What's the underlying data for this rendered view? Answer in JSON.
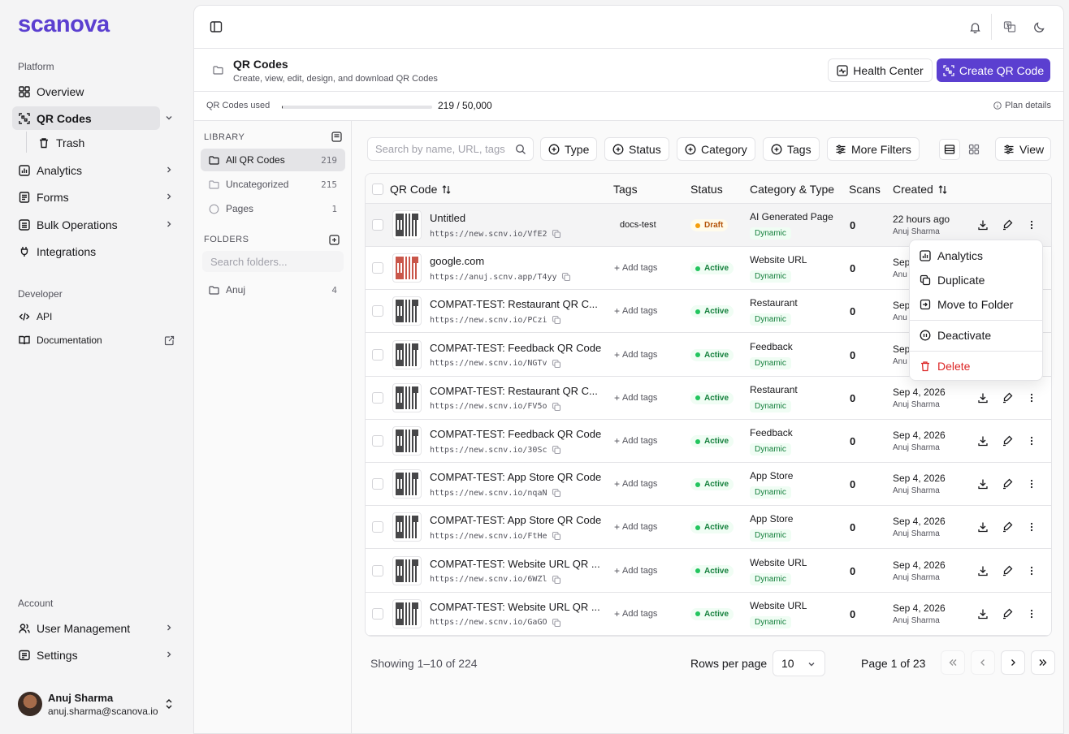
{
  "brand": {
    "logo_text": "scanova",
    "accent": "#5b3fd0"
  },
  "sidebar": {
    "platform_label": "Platform",
    "items": [
      {
        "label": "Overview",
        "icon": "grid-icon"
      },
      {
        "label": "QR Codes",
        "icon": "qr-scan-icon"
      },
      {
        "label": "Trash",
        "icon": "trash-icon"
      },
      {
        "label": "Analytics",
        "icon": "bar-chart-icon"
      },
      {
        "label": "Forms",
        "icon": "form-icon"
      },
      {
        "label": "Bulk Operations",
        "icon": "layers-icon"
      },
      {
        "label": "Integrations",
        "icon": "plug-icon"
      }
    ],
    "developer_label": "Developer",
    "dev_items": [
      {
        "label": "API",
        "icon": "code-icon"
      },
      {
        "label": "Documentation",
        "icon": "book-icon"
      }
    ],
    "account_label": "Account",
    "account_items": [
      {
        "label": "User Management",
        "icon": "users-icon"
      },
      {
        "label": "Settings",
        "icon": "settings-icon"
      }
    ],
    "user": {
      "name": "Anuj Sharma",
      "email": "anuj.sharma@scanova.io"
    }
  },
  "header": {
    "title": "QR Codes",
    "subtitle": "Create, view, edit, design, and download QR Codes",
    "health_center": "Health Center",
    "create": "Create QR Code"
  },
  "usage": {
    "label": "QR Codes used",
    "value_text": "219 / 50,000",
    "used": 219,
    "limit": 50000,
    "plan_details": "Plan details"
  },
  "library": {
    "title": "LIBRARY",
    "items": [
      {
        "label": "All QR Codes",
        "count": "219"
      },
      {
        "label": "Uncategorized",
        "count": "215"
      },
      {
        "label": "Pages",
        "count": "1"
      }
    ],
    "folders_title": "FOLDERS",
    "folder_search_placeholder": "Search folders...",
    "folders": [
      {
        "label": "Anuj",
        "count": "4"
      }
    ]
  },
  "toolbar": {
    "search_placeholder": "Search by name, URL, tags",
    "filters": [
      "Type",
      "Status",
      "Category",
      "Tags"
    ],
    "more_filters": "More Filters",
    "view": "View"
  },
  "table": {
    "columns": {
      "qr_code": "QR Code",
      "tags": "Tags",
      "status": "Status",
      "category_type": "Category & Type",
      "scans": "Scans",
      "created": "Created"
    },
    "rows": [
      {
        "name": "Untitled",
        "url": "https://new.scnv.io/VfE2",
        "tag": "docs-test",
        "status": "Draft",
        "category": "AI Generated Page",
        "type": "Dynamic",
        "scans": "0",
        "created": "22 hours ago",
        "by": "Anuj Sharma",
        "qr_color": "dark"
      },
      {
        "name": "google.com",
        "url": "https://anuj.scnv.app/T4yy",
        "tag": "",
        "status": "Active",
        "category": "Website URL",
        "type": "Dynamic",
        "scans": "0",
        "created": "Sep",
        "by": "Anu",
        "qr_color": "red"
      },
      {
        "name": "COMPAT-TEST: Restaurant QR C...",
        "url": "https://new.scnv.io/PCzi",
        "tag": "",
        "status": "Active",
        "category": "Restaurant",
        "type": "Dynamic",
        "scans": "0",
        "created": "Sep",
        "by": "Anu",
        "qr_color": "dark"
      },
      {
        "name": "COMPAT-TEST: Feedback QR Code",
        "url": "https://new.scnv.io/NGTv",
        "tag": "",
        "status": "Active",
        "category": "Feedback",
        "type": "Dynamic",
        "scans": "0",
        "created": "Sep",
        "by": "Anu",
        "qr_color": "dark"
      },
      {
        "name": "COMPAT-TEST: Restaurant QR C...",
        "url": "https://new.scnv.io/FV5o",
        "tag": "",
        "status": "Active",
        "category": "Restaurant",
        "type": "Dynamic",
        "scans": "0",
        "created": "Sep 4, 2026",
        "by": "Anuj Sharma",
        "qr_color": "dark"
      },
      {
        "name": "COMPAT-TEST: Feedback QR Code",
        "url": "https://new.scnv.io/30Sc",
        "tag": "",
        "status": "Active",
        "category": "Feedback",
        "type": "Dynamic",
        "scans": "0",
        "created": "Sep 4, 2026",
        "by": "Anuj Sharma",
        "qr_color": "dark"
      },
      {
        "name": "COMPAT-TEST: App Store QR Code",
        "url": "https://new.scnv.io/nqaN",
        "tag": "",
        "status": "Active",
        "category": "App Store",
        "type": "Dynamic",
        "scans": "0",
        "created": "Sep 4, 2026",
        "by": "Anuj Sharma",
        "qr_color": "dark"
      },
      {
        "name": "COMPAT-TEST: App Store QR Code",
        "url": "https://new.scnv.io/FtHe",
        "tag": "",
        "status": "Active",
        "category": "App Store",
        "type": "Dynamic",
        "scans": "0",
        "created": "Sep 4, 2026",
        "by": "Anuj Sharma",
        "qr_color": "dark"
      },
      {
        "name": "COMPAT-TEST: Website URL QR ...",
        "url": "https://new.scnv.io/6WZl",
        "tag": "",
        "status": "Active",
        "category": "Website URL",
        "type": "Dynamic",
        "scans": "0",
        "created": "Sep 4, 2026",
        "by": "Anuj Sharma",
        "qr_color": "dark"
      },
      {
        "name": "COMPAT-TEST: Website URL QR ...",
        "url": "https://new.scnv.io/GaGO",
        "tag": "",
        "status": "Active",
        "category": "Website URL",
        "type": "Dynamic",
        "scans": "0",
        "created": "Sep 4, 2026",
        "by": "Anuj Sharma",
        "qr_color": "dark"
      }
    ],
    "add_tags": "Add tags"
  },
  "pagination": {
    "showing": "Showing 1–10 of 224",
    "rows_per_page_label": "Rows per page",
    "rows_per_page": "10",
    "page_info": "Page 1 of 23"
  },
  "context_menu": {
    "items": [
      "Analytics",
      "Duplicate",
      "Move to Folder",
      "Deactivate",
      "Delete"
    ]
  }
}
